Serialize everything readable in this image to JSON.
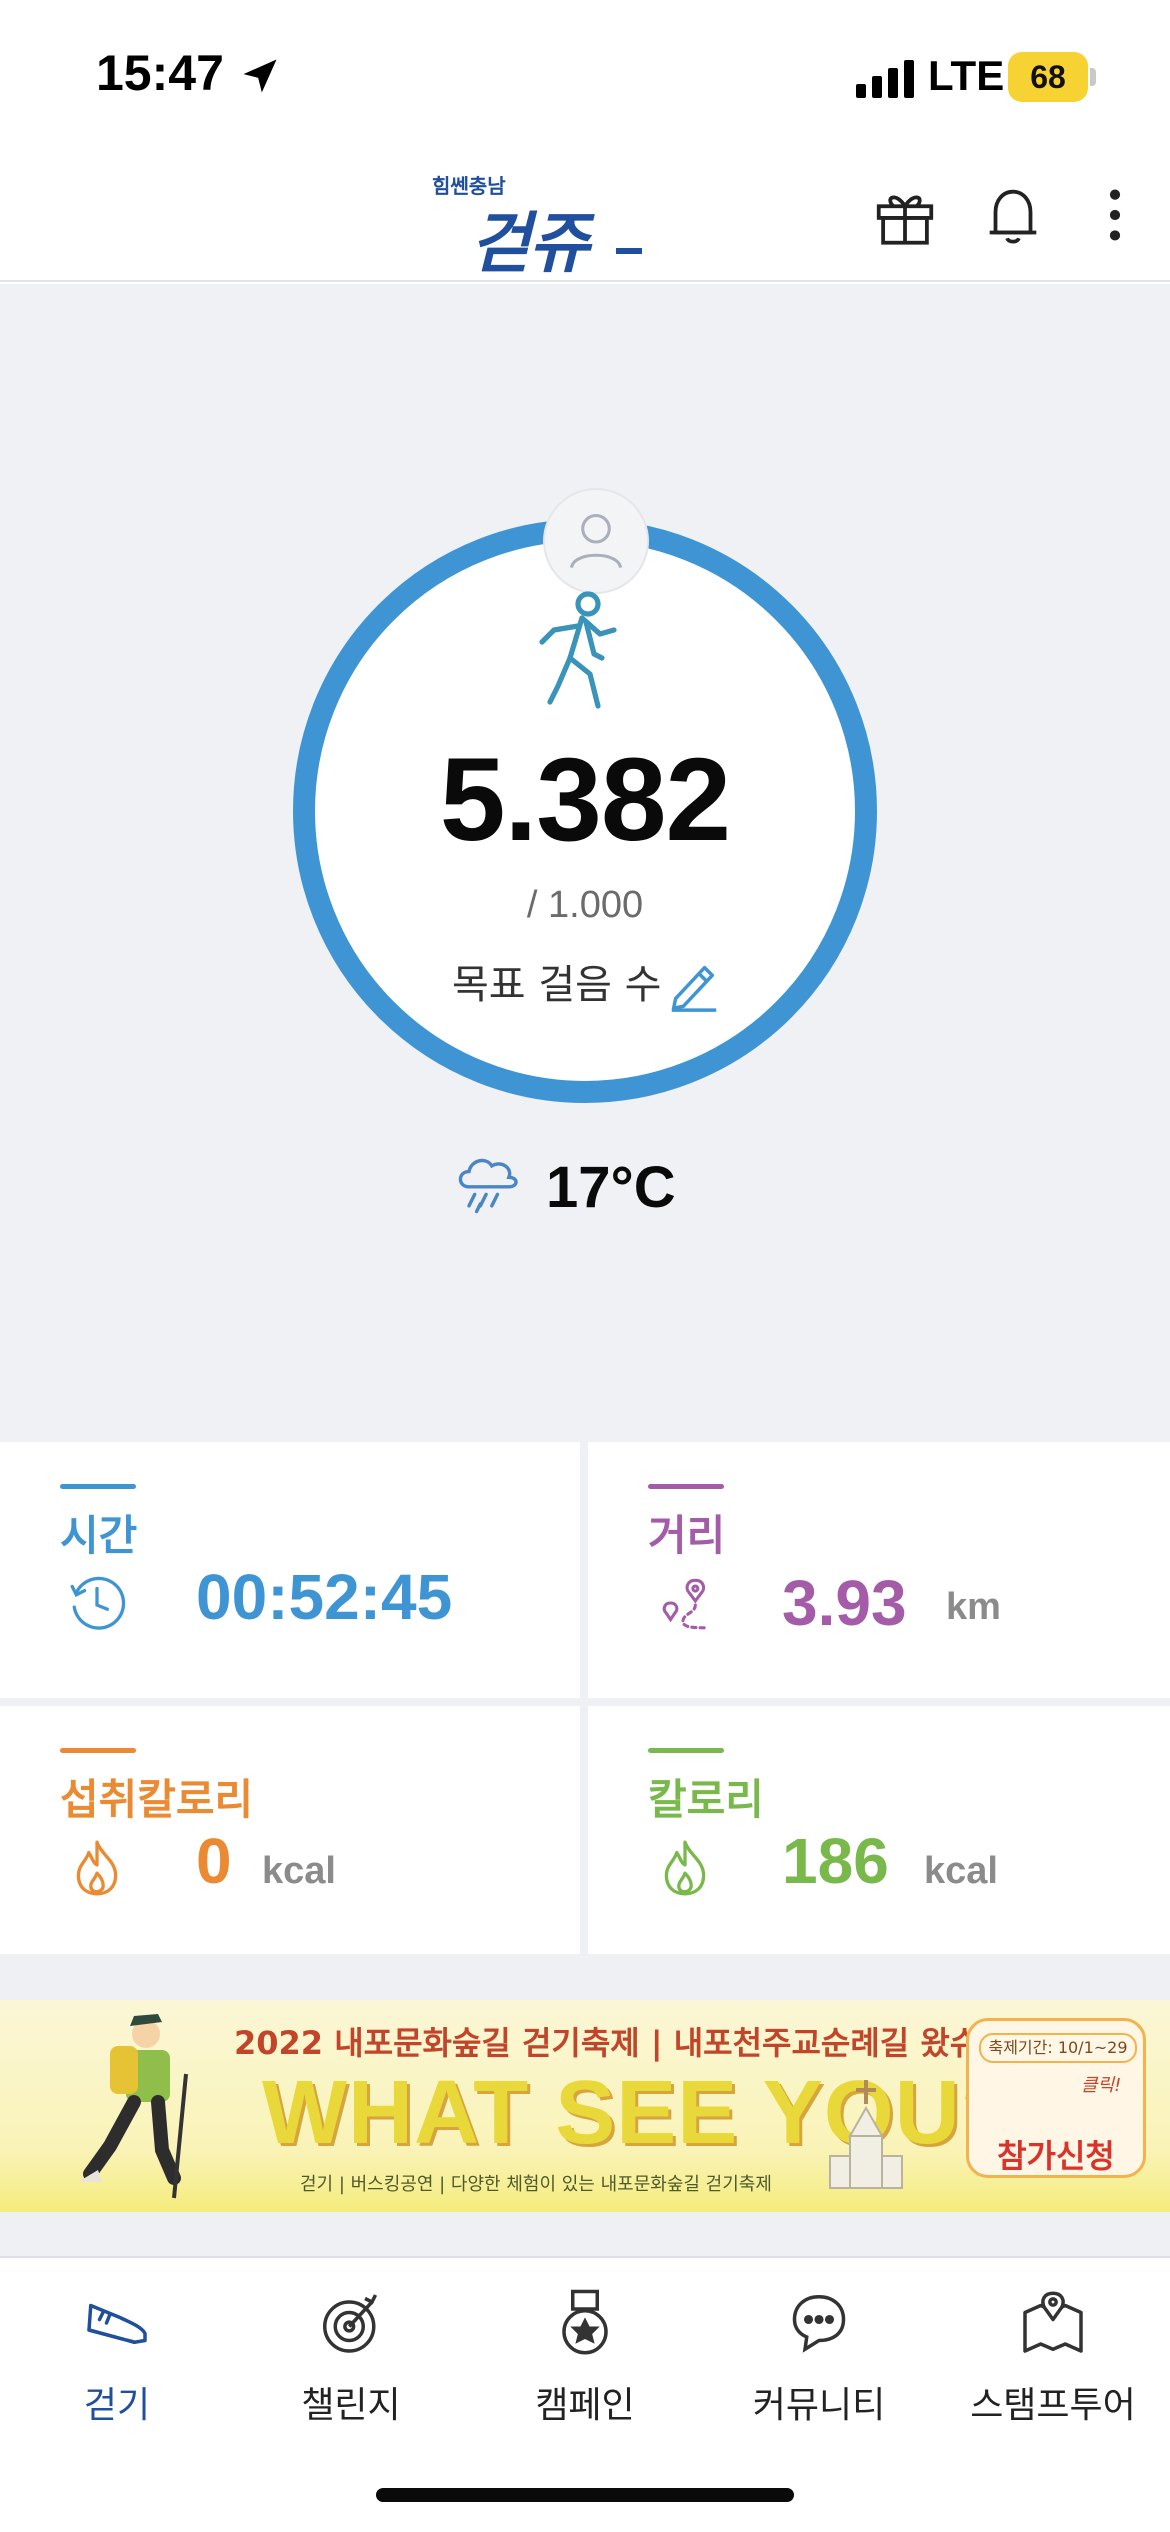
{
  "status_bar": {
    "time": "15:47",
    "network": "LTE",
    "battery": "68"
  },
  "header": {
    "logo_small": "힘쎈충남",
    "logo_main": "걷쥬",
    "icons": [
      "gift-icon",
      "bell-icon",
      "more-vertical-icon"
    ]
  },
  "walk": {
    "steps": "5.382",
    "goal": "/ 1.000",
    "goal_label": "목표 걸음 수",
    "progress": 1.0,
    "weather_icon": "rain-cloud-icon",
    "temperature": "17°C"
  },
  "stats": {
    "time": {
      "label": "시간",
      "value": "00:52:45",
      "color": "#3f95d4"
    },
    "distance": {
      "label": "거리",
      "value": "3.93",
      "unit": "km",
      "color": "#a45ca8"
    },
    "intake": {
      "label": "섭취칼로리",
      "value": "0",
      "unit": "kcal",
      "color": "#ea8a32"
    },
    "calories": {
      "label": "칼로리",
      "value": "186",
      "unit": "kcal",
      "color": "#79b84a"
    }
  },
  "banner": {
    "title": "2022 내포문화숲길 걷기축제 | 내포천주교순례길 왔슈?",
    "headline": "WHAT SEE YOU?",
    "subtitle": "걷기 | 버스킹공연 | 다양한 체험이 있는 내포문화숲길 걷기축제",
    "period": "축제기간: 10/1~29",
    "click": "클릭!",
    "cta": "참가신청"
  },
  "tabs": [
    {
      "label": "걷기",
      "icon": "shoe-icon",
      "active": true
    },
    {
      "label": "챌린지",
      "icon": "target-icon",
      "active": false
    },
    {
      "label": "캠페인",
      "icon": "medal-icon",
      "active": false
    },
    {
      "label": "커뮤니티",
      "icon": "chat-bubbles-icon",
      "active": false
    },
    {
      "label": "스탬프투어",
      "icon": "map-pin-icon",
      "active": false
    }
  ],
  "colors": {
    "accent": "#1f4f9d",
    "ring": "#3f95d4"
  }
}
